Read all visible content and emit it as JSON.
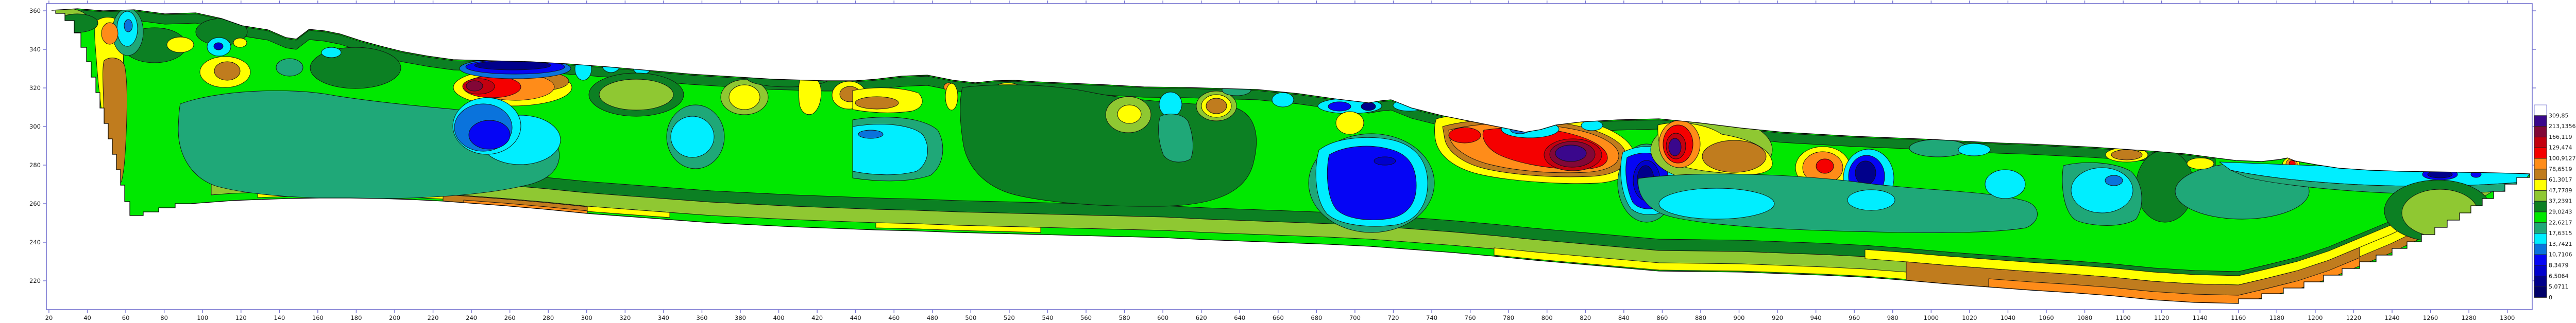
{
  "figure": {
    "kind": "filled-contour cross-section (resistivity pseudosection)",
    "background": "#ffffff"
  },
  "colors": {
    "frame": "#7573D0",
    "tick_label": "#1a1a1a",
    "contour_line": "#111111"
  },
  "axes": {
    "x": {
      "tick_min": 20,
      "tick_max": 1300,
      "tick_step": 20
    },
    "y": {
      "tick_min": 220,
      "tick_max": 360,
      "tick_step": 20
    }
  },
  "legend": {
    "labels": [
      "309,85",
      "213,1356",
      "166,119",
      "129,474",
      "100,9127",
      "78,6519",
      "61,3017",
      "47,7789",
      "37,2391",
      "29,0243",
      "22,6217",
      "17,6315",
      "13,7421",
      "10,7106",
      "8,3479",
      "6,5064",
      "5,0711",
      "0"
    ],
    "box_colors_top_to_bottom": [
      "#FFFFFF",
      "#3A078C",
      "#820737",
      "#C30010",
      "#F50000",
      "#FF8C19",
      "#C07C1E",
      "#FFFF00",
      "#8FC832",
      "#0C8023",
      "#00E800",
      "#1FA878",
      "#00EEFF",
      "#0A73DC",
      "#0505F5",
      "#0000CD",
      "#00008B",
      "#000069"
    ]
  },
  "palette": {
    "white": "#FFFFFF",
    "purple": "#3A078C",
    "maroon": "#820737",
    "dkred": "#C30010",
    "red": "#F50000",
    "orange": "#FF8C19",
    "brown": "#C07C1E",
    "yellow": "#FFFF00",
    "olive": "#8FC832",
    "dkgreen": "#0C8023",
    "green": "#00E800",
    "teal": "#1FA878",
    "cyan": "#00EEFF",
    "azure": "#0A73DC",
    "blue": "#0505F5",
    "mblue": "#0000CD",
    "dblue": "#00008B",
    "navy": "#000069"
  },
  "chart_data": {
    "type": "heatmap",
    "subtype": "filled-contour elevation/distance section",
    "title": "",
    "xlabel": "",
    "ylabel": "",
    "x_axis": {
      "min": 18,
      "max": 1313,
      "tick_step": 20,
      "first_tick": 20,
      "last_tick": 1300
    },
    "y_axis": {
      "min": 205,
      "max": 364,
      "tick_step": 20,
      "first_tick": 220,
      "last_tick": 360
    },
    "grid": false,
    "legend_position": "right",
    "color_scale": {
      "boundaries_low_to_high": [
        0,
        5.0711,
        6.5064,
        8.3479,
        10.7106,
        13.7421,
        17.6315,
        22.6217,
        29.0243,
        37.2391,
        47.7789,
        61.3017,
        78.6519,
        100.9127,
        129.474,
        166.119,
        213.1356,
        309.85
      ],
      "display_labels_top_to_bottom": [
        "309,85",
        "213,1356",
        "166,119",
        "129,474",
        "100,9127",
        "78,6519",
        "61,3017",
        "47,7789",
        "37,2391",
        "29,0243",
        "22,6217",
        "17,6315",
        "13,7421",
        "10,7106",
        "8,3479",
        "6,5064",
        "5,0711",
        "0"
      ],
      "colors_low_to_high": [
        "#000069",
        "#00008B",
        "#0000CD",
        "#0505F5",
        "#0A73DC",
        "#00EEFF",
        "#1FA878",
        "#00E800",
        "#0C8023",
        "#8FC832",
        "#FFFF00",
        "#C07C1E",
        "#FF8C19",
        "#F50000",
        "#C30010",
        "#820737",
        "#3A078C",
        "#FFFFFF"
      ]
    },
    "surface_profile_samples": [
      {
        "x": 21,
        "elev": 360
      },
      {
        "x": 120,
        "elev": 352
      },
      {
        "x": 145,
        "elev": 346
      },
      {
        "x": 231,
        "elev": 335
      },
      {
        "x": 330,
        "elev": 331
      },
      {
        "x": 440,
        "elev": 324
      },
      {
        "x": 560,
        "elev": 321
      },
      {
        "x": 649,
        "elev": 319
      },
      {
        "x": 730,
        "elev": 310
      },
      {
        "x": 791,
        "elev": 297
      },
      {
        "x": 830,
        "elev": 303
      },
      {
        "x": 858,
        "elev": 304
      },
      {
        "x": 960,
        "elev": 296
      },
      {
        "x": 1067,
        "elev": 290
      },
      {
        "x": 1150,
        "elev": 284
      },
      {
        "x": 1185,
        "elev": 283
      },
      {
        "x": 1250,
        "elev": 277
      },
      {
        "x": 1312,
        "elev": 275
      }
    ],
    "features": [
      {
        "kind": "shallow high-resistivity column",
        "x_range": [
          44,
          62
        ],
        "elev_range": [
          270,
          357
        ],
        "class": "61–101"
      },
      {
        "kind": "shallow conductive patch",
        "x_range": [
          56,
          68
        ],
        "elev_range": [
          340,
          357
        ],
        "class": "13.7–17.6"
      },
      {
        "kind": "conductive streak at surface",
        "x_range": [
          237,
          289
        ],
        "elev_range": [
          327,
          332
        ],
        "class": "<5.07"
      },
      {
        "kind": "high-resistivity core",
        "x_range": [
          233,
          270
        ],
        "elev_range": [
          314,
          326
        ],
        "class": "166–213"
      },
      {
        "kind": "conductive blob",
        "x_range": [
          230,
          268
        ],
        "elev_range": [
          286,
          316
        ],
        "class": "8.3–10.7"
      },
      {
        "kind": "conductive zone",
        "x_range": [
          440,
          475
        ],
        "elev_range": [
          278,
          302
        ],
        "class": "13.7–17.6"
      },
      {
        "kind": "conductive blob",
        "x_range": [
          680,
          735
        ],
        "elev_range": [
          250,
          287
        ],
        "class": "6.5–8.3"
      },
      {
        "kind": "large high-resistivity body",
        "x_range": [
          741,
          847
        ],
        "elev_range": [
          270,
          308
        ],
        "class": "213–310 core"
      },
      {
        "kind": "deep conductive blob",
        "x_range": [
          837,
          861
        ],
        "elev_range": [
          254,
          292
        ],
        "class": "5.07–6.5"
      },
      {
        "kind": "high-resistivity body",
        "x_range": [
          858,
          918
        ],
        "elev_range": [
          275,
          304
        ],
        "class": "213–310 core"
      },
      {
        "kind": "high-resistivity blob",
        "x_range": [
          930,
          953
        ],
        "elev_range": [
          270,
          288
        ],
        "class": "100.9–129.5"
      },
      {
        "kind": "conductive blob",
        "x_range": [
          957,
          977
        ],
        "elev_range": [
          262,
          285
        ],
        "class": "5.07–6.5"
      },
      {
        "kind": "deep high-resistivity basal mass",
        "x_range": [
          973,
          1244
        ],
        "elev_range": [
          208,
          235
        ],
        "class": "78.7–100.9"
      },
      {
        "kind": "shallow conductive band at right end",
        "x_range": [
          1150,
          1311
        ],
        "elev_range": [
          270,
          278
        ],
        "class": "5.07–13.7"
      },
      {
        "kind": "mid-depth sea-green (17.6–22.6) masses along section",
        "x_range": [
          90,
          1060
        ],
        "elev_range": [
          240,
          312
        ],
        "class": "17.6–22.6"
      }
    ]
  }
}
